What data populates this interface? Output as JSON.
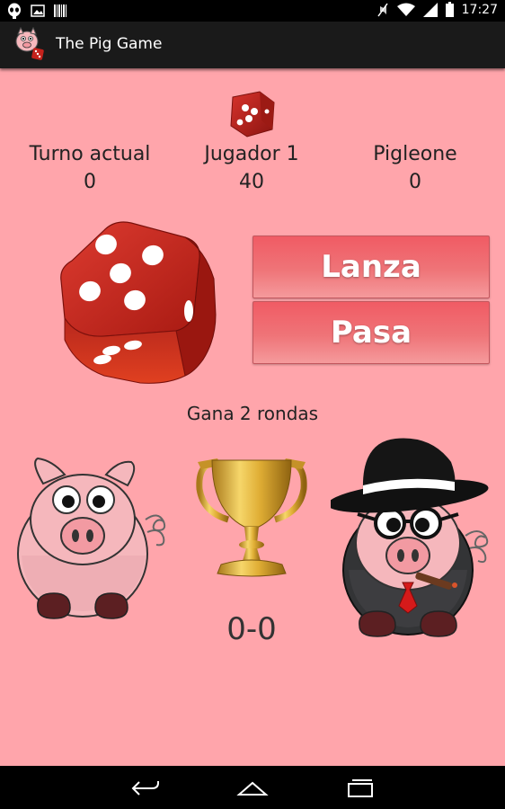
{
  "status_bar": {
    "time": "17:27",
    "icons": [
      "alien-icon",
      "image-icon",
      "barcode-icon",
      "mute-icon",
      "wifi-icon",
      "signal-icon",
      "battery-icon"
    ]
  },
  "app": {
    "title": "The Pig Game"
  },
  "scoreboard": {
    "columns": [
      {
        "label": "Turno actual",
        "value": "0"
      },
      {
        "label": "Jugador 1",
        "value": "40"
      },
      {
        "label": "Pigleone",
        "value": "0"
      }
    ]
  },
  "controls": {
    "roll_label": "Lanza",
    "pass_label": "Pasa",
    "die_face": 5
  },
  "match": {
    "rounds_text": "Gana 2 rondas",
    "score": "0-0"
  },
  "colors": {
    "background": "#ffa5ab",
    "button": "#ef6a70",
    "die": "#c4221c"
  },
  "nav": {
    "icons": [
      "back-icon",
      "home-icon",
      "recents-icon"
    ]
  }
}
